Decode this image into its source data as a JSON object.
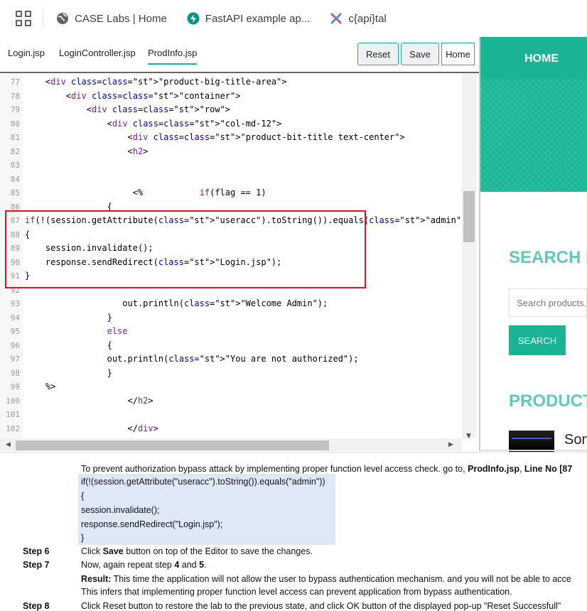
{
  "bookmarks": [
    {
      "label": "CASE Labs | Home",
      "icon": "globe-icon"
    },
    {
      "label": "FastAPI example ap...",
      "icon": "fastapi-icon"
    },
    {
      "label": "c{api}tal",
      "icon": "capital-x-icon"
    }
  ],
  "editor": {
    "tabs": [
      "Login.jsp",
      "LoginController.jsp",
      "ProdInfo.jsp"
    ],
    "active_tab": "ProdInfo.jsp",
    "buttons": {
      "reset": "Reset",
      "save": "Save",
      "home": "Home"
    },
    "lines": [
      {
        "n": "77",
        "t": "    <div class=\"product-big-title-area\">"
      },
      {
        "n": "78",
        "t": "        <div class=\"container\">"
      },
      {
        "n": "79",
        "t": "            <div class=\"row\">"
      },
      {
        "n": "80",
        "t": "                <div class=\"col-md-12\">"
      },
      {
        "n": "81",
        "t": "                    <div class=\"product-bit-title text-center\">"
      },
      {
        "n": "82",
        "t": "                    <h2>"
      },
      {
        "n": "83",
        "t": ""
      },
      {
        "n": "84",
        "t": ""
      },
      {
        "n": "85",
        "t": "                     <%           if(flag == 1)"
      },
      {
        "n": "86",
        "t": "                {"
      },
      {
        "n": "87",
        "t": "if(!(session.getAttribute(\"useracc\").toString()).equals(\"admin\"))"
      },
      {
        "n": "88",
        "t": "{"
      },
      {
        "n": "89",
        "t": "    session.invalidate();"
      },
      {
        "n": "90",
        "t": "    response.sendRedirect(\"Login.jsp\");"
      },
      {
        "n": "91",
        "t": "}"
      },
      {
        "n": "92",
        "t": ""
      },
      {
        "n": "93",
        "t": "                   out.println(\"Welcome Admin\");"
      },
      {
        "n": "94",
        "t": "                }"
      },
      {
        "n": "95",
        "t": "                else"
      },
      {
        "n": "96",
        "t": "                {"
      },
      {
        "n": "97",
        "t": "                out.println(\"You are not authorized\");"
      },
      {
        "n": "98",
        "t": "                }"
      },
      {
        "n": "99",
        "t": "    %>"
      },
      {
        "n": "100",
        "t": "                    </h2>"
      },
      {
        "n": "101",
        "t": ""
      },
      {
        "n": "102",
        "t": "                    </div>"
      }
    ]
  },
  "preview": {
    "nav_home": "HOME",
    "search_title": "SEARCH P",
    "search_placeholder": "Search products...",
    "search_button": "SEARCH",
    "products_title": "PRODUCTS",
    "product_name": "Son"
  },
  "instructions": {
    "intro_prefix": "To prevent authorization bypass attack by implementing proper function level access check. go to, ",
    "intro_file": "ProdInfo.jsp",
    "intro_sep": ", ",
    "intro_line": "Line No [87",
    "code": [
      "if(!(session.getAttribute(\"useracc\").toString()).equals(\"admin\"))",
      "{",
      "session.invalidate();",
      "response.sendRedirect(\"Login.jsp\");",
      "}"
    ],
    "step6_label": "Step 6",
    "step6_a": "Click ",
    "step6_b": "Save",
    "step6_c": " button on top of the Editor to save the changes.",
    "step7_label": "Step 7",
    "step7_a": "Now, again repeat step ",
    "step7_b": "4",
    "step7_c": " and ",
    "step7_d": "5",
    "step7_e": ".",
    "result_label": "Result:",
    "result_text": " This time the application will not allow the user to bypass authentication mechanism. and you will not be able to acce",
    "infer_text": "This infers that implementing proper function level access can prevent application from bypass authentication.",
    "step8_label": "Step 8",
    "step8_text": "Click Reset button to restore the lab to the previous state, and click OK button of the displayed pop-up \"Reset Successfull\""
  }
}
